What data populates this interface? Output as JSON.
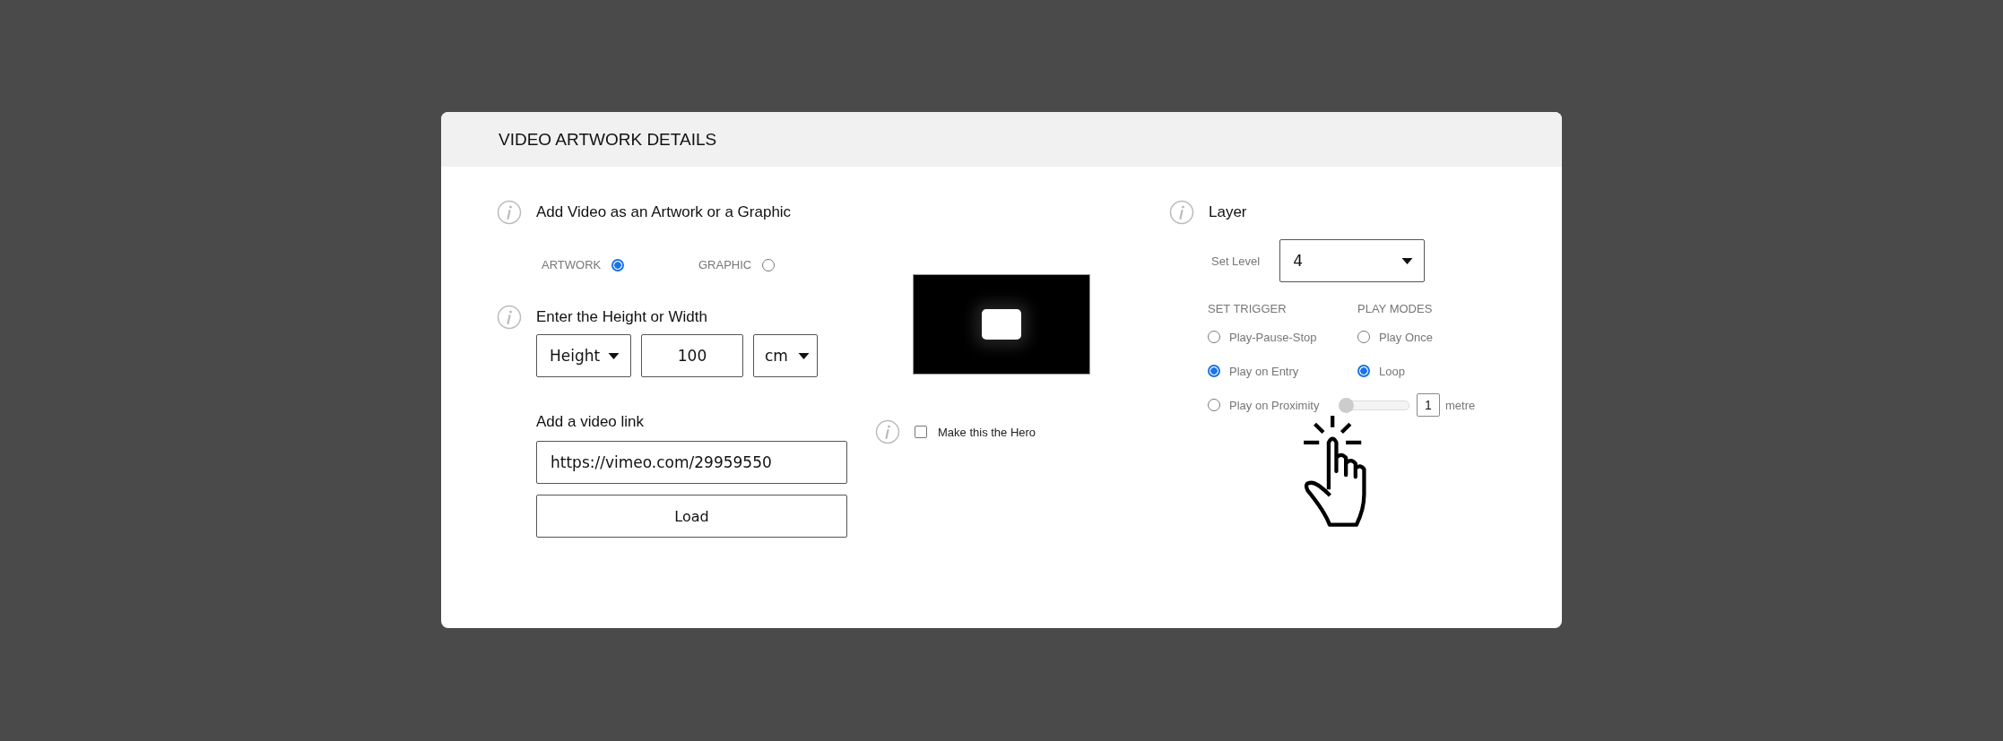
{
  "header": {
    "title": "VIDEO ARTWORK DETAILS"
  },
  "artwork_type": {
    "heading": "Add Video as an Artwork or a Graphic",
    "options": [
      {
        "label": "ARTWORK",
        "selected": true
      },
      {
        "label": "GRAPHIC",
        "selected": false
      }
    ]
  },
  "size": {
    "heading": "Enter the Height or Width",
    "dimension": "Height",
    "value": "100",
    "unit": "cm"
  },
  "video_link": {
    "heading": "Add a video link",
    "value": "https://vimeo.com/29959550",
    "button": "Load"
  },
  "hero": {
    "label": "Make this the Hero",
    "checked": false
  },
  "layer": {
    "heading": "Layer",
    "set_level_label": "Set Level",
    "level_value": "4",
    "trigger_heading": "SET TRIGGER",
    "modes_heading": "PLAY MODES",
    "triggers": [
      {
        "label": "Play-Pause-Stop",
        "selected": false
      },
      {
        "label": "Play on Entry",
        "selected": true
      },
      {
        "label": "Play on Proximity",
        "selected": false
      }
    ],
    "modes": [
      {
        "label": "Play Once",
        "selected": false
      },
      {
        "label": "Loop",
        "selected": true
      }
    ],
    "proximity": {
      "level": 0,
      "value": "1",
      "unit": "metre"
    }
  }
}
